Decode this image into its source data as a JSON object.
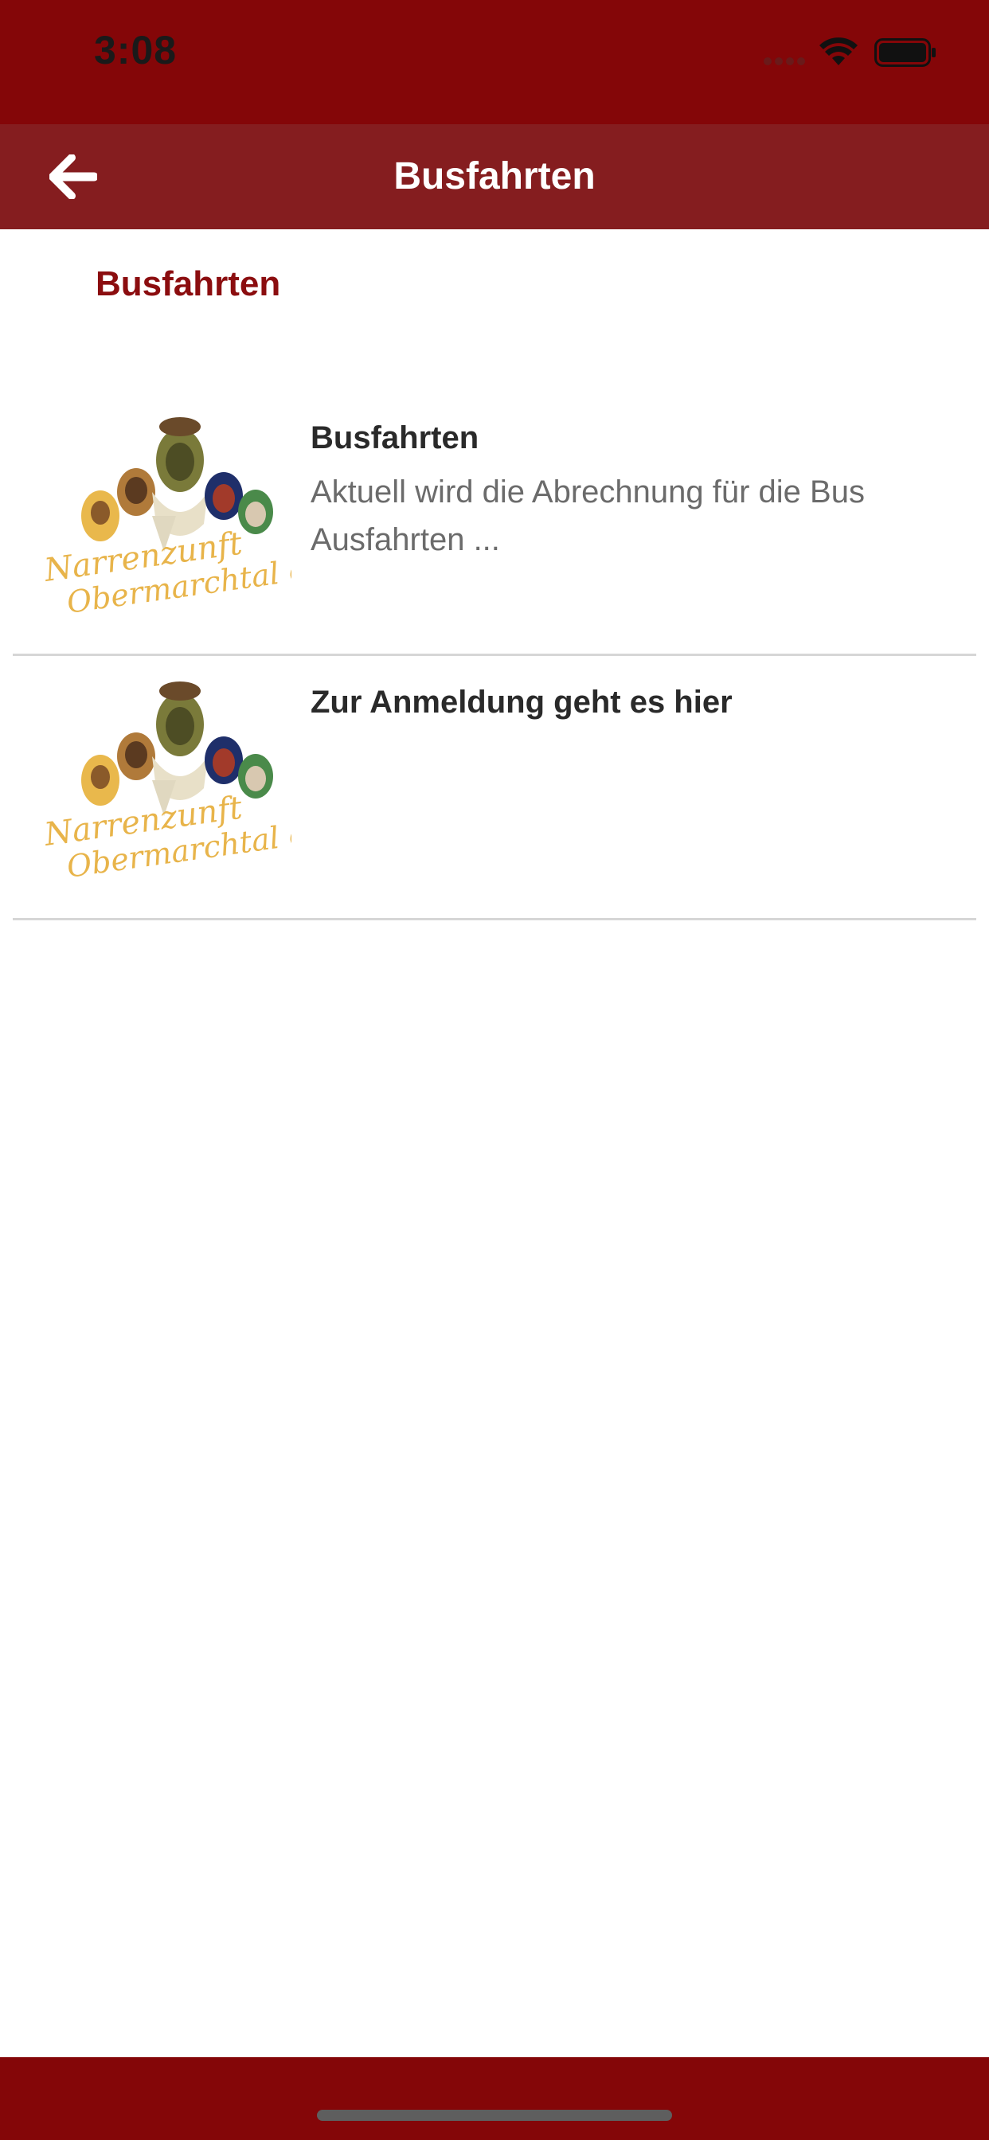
{
  "status": {
    "time": "3:08",
    "icons": [
      "signal-dots-icon",
      "wifi-icon",
      "battery-icon"
    ]
  },
  "nav": {
    "title": "Busfahrten",
    "back_icon": "arrow-left-icon"
  },
  "section": {
    "title": "Busfahrten"
  },
  "items": [
    {
      "title": "Busfahrten",
      "description": "Aktuell wird die Abrechnung für die Bus Ausfahrten ...",
      "logo_text": [
        "Narrenzunft",
        "Obermarchtal e.V."
      ]
    },
    {
      "title": "Zur Anmeldung geht es hier",
      "description": "",
      "logo_text": [
        "Narrenzunft",
        "Obermarchtal e.V."
      ]
    }
  ],
  "colors": {
    "status_bar": "#840608",
    "nav_bar": "#851d1f",
    "accent_text": "#8b0d0f",
    "logo_gold": "#e8b44a"
  }
}
